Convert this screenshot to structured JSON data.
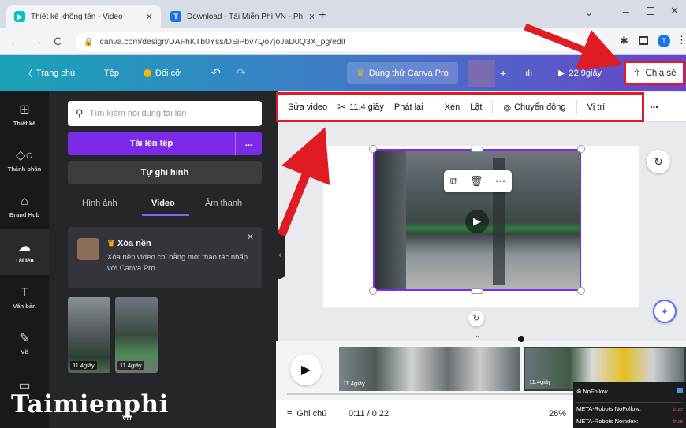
{
  "browser": {
    "tabs": [
      {
        "title": "Thiết kế không tên - Video",
        "active": true
      },
      {
        "title": "Download - Tải Miễn Phí VN - Ph",
        "active": false
      }
    ],
    "url": "canva.com/design/DAFhKTb0Yss/DSiPbv7Qo7joJaD0Q3X_pg/edit"
  },
  "topbar": {
    "home": "Trang chủ",
    "file": "Tệp",
    "resize": "Đổi cỡ",
    "try_pro": "Dùng thử Canva Pro",
    "duration": "22.9giây",
    "share": "Chia sẻ"
  },
  "rail": [
    {
      "label": "Thiết kế",
      "icon": "layout-icon"
    },
    {
      "label": "Thành phần",
      "icon": "elements-icon"
    },
    {
      "label": "Brand Hub",
      "icon": "brand-hub-icon"
    },
    {
      "label": "Tải lên",
      "icon": "upload-cloud-icon",
      "active": true
    },
    {
      "label": "Văn bản",
      "icon": "text-icon"
    },
    {
      "label": "Vẽ",
      "icon": "draw-icon"
    }
  ],
  "panel": {
    "search_placeholder": "Tìm kiếm nội dung tải lên",
    "upload_label": "Tải lên tệp",
    "upload_more": "...",
    "record_label": "Tự ghi hình",
    "tabs": [
      "Hình ảnh",
      "Video",
      "Âm thanh"
    ],
    "active_tab": "Video",
    "notice_title": "Xóa nền",
    "notice_text": "Xóa nền video chỉ bằng một thao tác nhấp với Canva Pro.",
    "thumbs": [
      {
        "duration": "11.4giây"
      },
      {
        "duration": "11.4giây"
      }
    ]
  },
  "context_toolbar": {
    "edit_video": "Sửa video",
    "trim": "11.4 giây",
    "playback": "Phát lại",
    "crop": "Xén",
    "flip": "Lật",
    "animate": "Chuyển động",
    "position": "Vị trí",
    "more": "..."
  },
  "timeline": {
    "clips": [
      {
        "duration": "11.4giây"
      },
      {
        "duration": "11.4giây"
      }
    ]
  },
  "bottom": {
    "notes": "Ghi chú",
    "time": "0:11 / 0:22",
    "zoom": "26%"
  },
  "seo_overlay": {
    "title": "NoFollow",
    "rows": [
      {
        "label": "META-Robots NoFollow:",
        "value": "true"
      },
      {
        "label": "META-Robots Noindex:",
        "value": "true"
      }
    ]
  },
  "logo": {
    "main": "Taimienphi",
    "sub": ".vn"
  },
  "colors": {
    "accent": "#7d2ae8",
    "highlight": "#e01b24"
  }
}
